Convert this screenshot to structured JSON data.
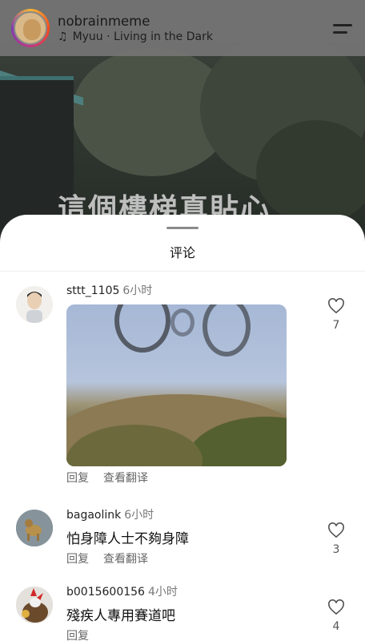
{
  "header": {
    "username": "nobrainmeme",
    "music_text": "Myuu · Living in the Dark",
    "music_icon": "music-note-icon",
    "menu_icon": "menu-icon"
  },
  "background": {
    "caption": "這個樓梯真貼心"
  },
  "sheet": {
    "title": "评论"
  },
  "comments": [
    {
      "user": "sttt_1105",
      "time": "6小时",
      "text": "",
      "has_image": true,
      "actions": [
        "回复",
        "查看翻译"
      ],
      "likes": "7"
    },
    {
      "user": "bagaolink",
      "time": "6小时",
      "text": "怕身障人士不夠身障",
      "actions": [
        "回复",
        "查看翻译"
      ],
      "likes": "3"
    },
    {
      "user": "b0015600156",
      "time": "4小时",
      "text": "殘疾人專用賽道吧",
      "actions": [
        "回复"
      ],
      "likes": "4"
    }
  ],
  "colors": {
    "header_bg": "#787878",
    "sheet_bg": "#ffffff",
    "muted_text": "#777777"
  }
}
